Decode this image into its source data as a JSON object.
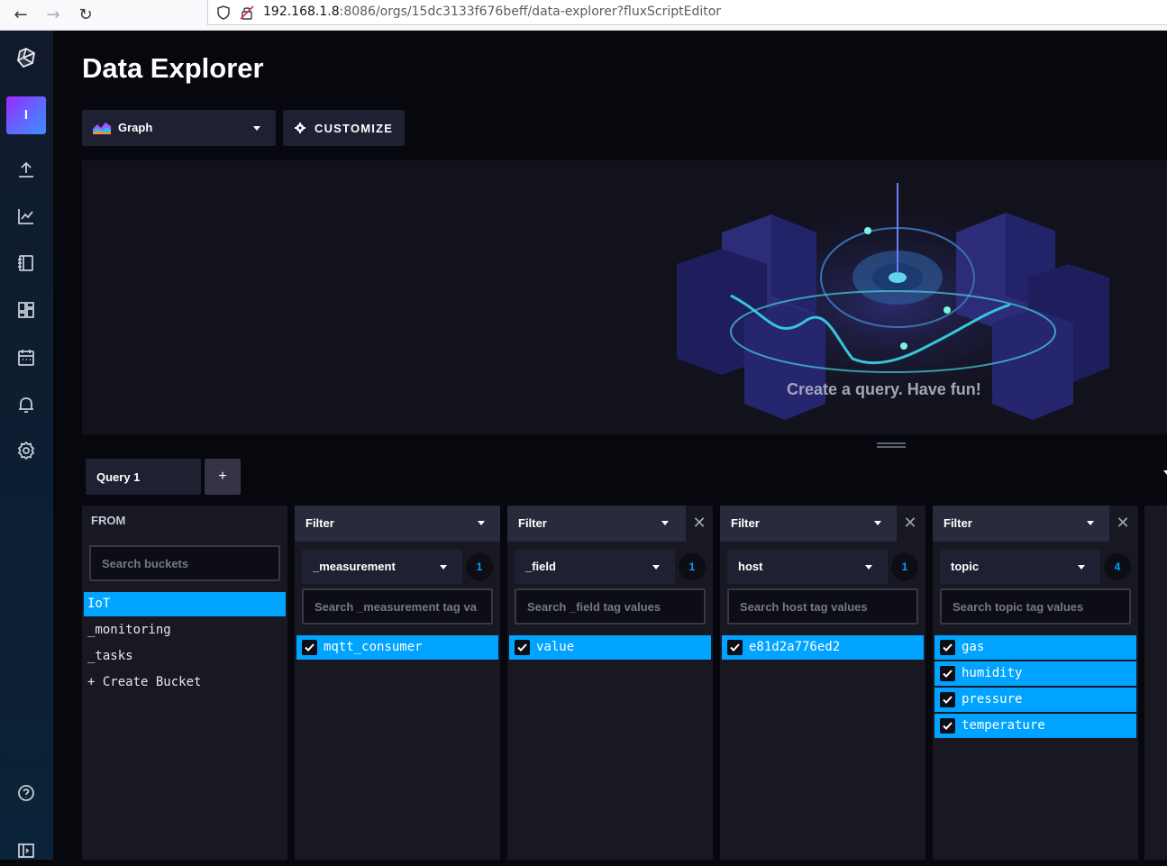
{
  "browser": {
    "url_host": "192.168.1.8",
    "url_rest": ":8086/orgs/15dc3133f676beff/data-explorer?fluxScriptEditor"
  },
  "sidebar": {
    "org_initial": "I",
    "icons": [
      "influx-logo-icon",
      "upload-icon",
      "graph-icon",
      "notebook-icon",
      "dashboards-icon",
      "calendar-icon",
      "bell-icon",
      "gear-icon",
      "help-icon",
      "expand-icon"
    ]
  },
  "page": {
    "title": "Data Explorer",
    "vis_type": "Graph",
    "customize_label": "CUSTOMIZE",
    "empty_message": "Create a query. Have fun!"
  },
  "query": {
    "tab_label": "Query 1",
    "add_label": "+"
  },
  "from": {
    "header": "FROM",
    "search_placeholder": "Search buckets",
    "buckets": [
      {
        "name": "IoT",
        "selected": true
      },
      {
        "name": "_monitoring",
        "selected": false
      },
      {
        "name": "_tasks",
        "selected": false
      },
      {
        "name": "+ Create Bucket",
        "selected": false
      }
    ]
  },
  "filters": [
    {
      "header": "Filter",
      "key": "_measurement",
      "count": "1",
      "placeholder": "Search _measurement tag va",
      "values": [
        "mqtt_consumer"
      ]
    },
    {
      "header": "Filter",
      "key": "_field",
      "count": "1",
      "placeholder": "Search _field tag values",
      "values": [
        "value"
      ]
    },
    {
      "header": "Filter",
      "key": "host",
      "count": "1",
      "placeholder": "Search host tag values",
      "values": [
        "e81d2a776ed2"
      ]
    },
    {
      "header": "Filter",
      "key": "topic",
      "count": "4",
      "placeholder": "Search topic tag values",
      "values": [
        "gas",
        "humidity",
        "pressure",
        "temperature"
      ]
    }
  ],
  "colors": {
    "accent": "#00a3ff",
    "background": "#07070e",
    "panel": "#181822"
  }
}
